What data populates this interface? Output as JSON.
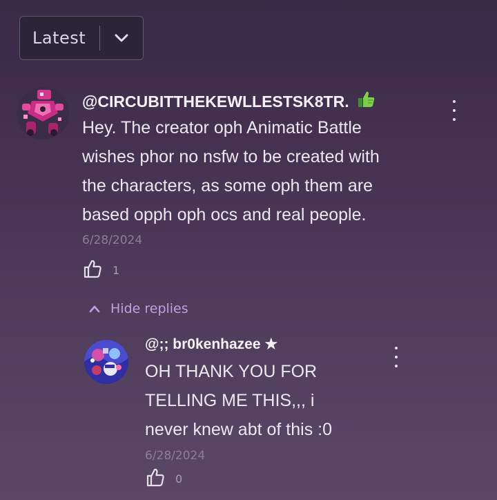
{
  "sort": {
    "label": "Latest",
    "chevron_icon": "chevron-down-icon"
  },
  "comments": [
    {
      "author": "@CIRCUBITTHEKEWLLESTSK8TR.",
      "badge_icon": "thumbs-up-emoji-icon",
      "lines": [
        "Hey. The creator oph Animatic Battle",
        "wishes phor no nsfw to be created with",
        "the characters, as some oph them are",
        "based opph oph ocs and real people."
      ],
      "date": "6/28/2024",
      "likes": "1"
    }
  ],
  "replies_toggle": {
    "label": "Hide replies",
    "icon": "chevron-up-icon"
  },
  "replies": [
    {
      "author": "@;; br0kenhazee ★",
      "lines": [
        "OH THANK YOU FOR",
        "TELLING ME THIS,,, i",
        "never knew abt of this :0"
      ],
      "date": "6/28/2024",
      "likes": "0"
    }
  ],
  "colors": {
    "accent": "#b9a3e0",
    "background_top": "#3a2a46",
    "background_bottom": "#5b4766"
  }
}
